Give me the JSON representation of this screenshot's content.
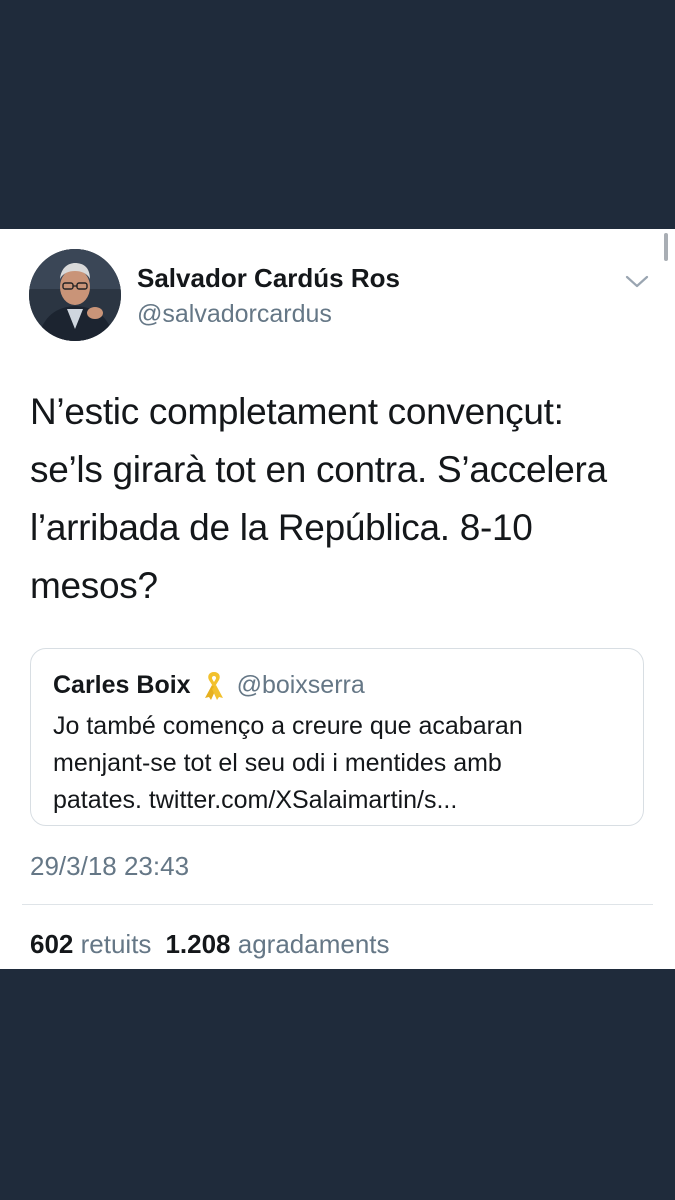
{
  "tweet": {
    "author_name": "Salvador Cardús Ros",
    "author_handle": "@salvadorcardus",
    "text_lines": [
      "N’estic completament convençut:",
      "se’ls girarà tot en contra. S’accelera",
      "l’arribada de la República. 8-10",
      "mesos?"
    ],
    "timestamp": "29/3/18 23:43",
    "retweets_count": "602",
    "retweets_label": "retuits",
    "likes_count": "1.208",
    "likes_label": "agradaments"
  },
  "quoted_tweet": {
    "author_name": "Carles Boix",
    "badge_icon": "yellow-ribbon-icon",
    "author_handle": "@boixserra",
    "text_lines": [
      "Jo també començo a creure que acabaran",
      "menjant-se tot el seu odi i mentides amb",
      "patates. twitter.com/XSalaimartin/s..."
    ]
  },
  "icons": {
    "menu": "chevron-down-icon"
  },
  "colors": {
    "background": "#1f2b3b",
    "card": "#ffffff",
    "primary_text": "#14171a",
    "secondary_text": "#657786",
    "ribbon": "#f2c12e"
  }
}
